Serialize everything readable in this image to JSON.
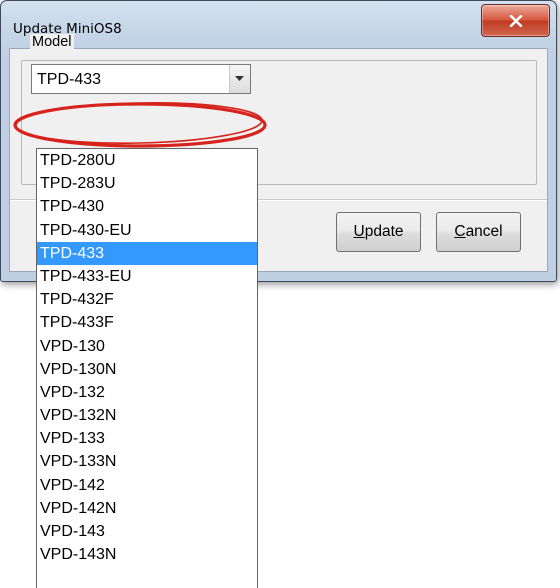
{
  "window": {
    "title": "Update MiniOS8",
    "close_icon": "close-icon"
  },
  "group": {
    "label": "Model"
  },
  "combo": {
    "selected_value": "TPD-433"
  },
  "buttons": {
    "update_label": "Update",
    "update_mnemonic": "U",
    "cancel_label": "Cancel",
    "cancel_mnemonic": "C"
  },
  "dropdown": {
    "items": [
      "TPD-280U",
      "TPD-283U",
      "TPD-430",
      "TPD-430-EU",
      "TPD-433",
      "TPD-433-EU",
      "TPD-432F",
      "TPD-433F",
      "VPD-130",
      "VPD-130N",
      "VPD-132",
      "VPD-132N",
      "VPD-133",
      "VPD-133N",
      "VPD-142",
      "VPD-142N",
      "VPD-143",
      "VPD-143N"
    ],
    "selected_index": 4
  },
  "colors": {
    "selection": "#3399ff",
    "annotation": "#d6231b",
    "close_button": "#c13b21"
  }
}
